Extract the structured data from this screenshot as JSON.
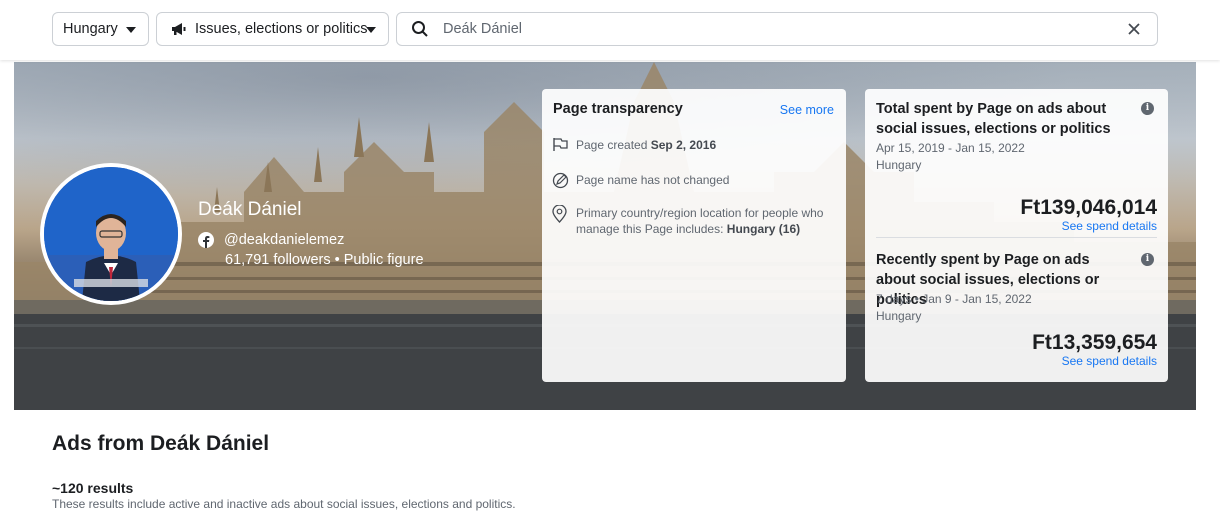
{
  "filters": {
    "country": "Hungary",
    "category": "Issues, elections or politics",
    "search_value": "Deák Dániel"
  },
  "profile": {
    "name": "Deák Dániel",
    "handle": "@deakdanielemez",
    "followers_line": "61,791 followers • Public figure"
  },
  "transparency": {
    "title": "Page transparency",
    "see_more": "See more",
    "created_label": "Page created",
    "created_date": "Sep 2, 2016",
    "name_changed": "Page name has not changed",
    "location_text": "Primary country/region location for people who manage this Page includes:",
    "location_value": "Hungary (16)"
  },
  "spend_total": {
    "title": "Total spent by Page on ads about social issues, elections or politics",
    "date_range": "Apr 15, 2019 - Jan 15, 2022",
    "country": "Hungary",
    "amount": "Ft139,046,014",
    "link": "See spend details"
  },
  "spend_recent": {
    "title": "Recently spent by Page on ads about social issues, elections or politics",
    "date_range": "7 days • Jan 9 - Jan 15, 2022",
    "country": "Hungary",
    "amount": "Ft13,359,654",
    "link": "See spend details"
  },
  "ads": {
    "title": "Ads from Deák Dániel",
    "results": "~120 results",
    "note": "These results include active and inactive ads about social issues, elections and politics."
  },
  "colors": {
    "link": "#1877f2",
    "muted": "#606770"
  }
}
